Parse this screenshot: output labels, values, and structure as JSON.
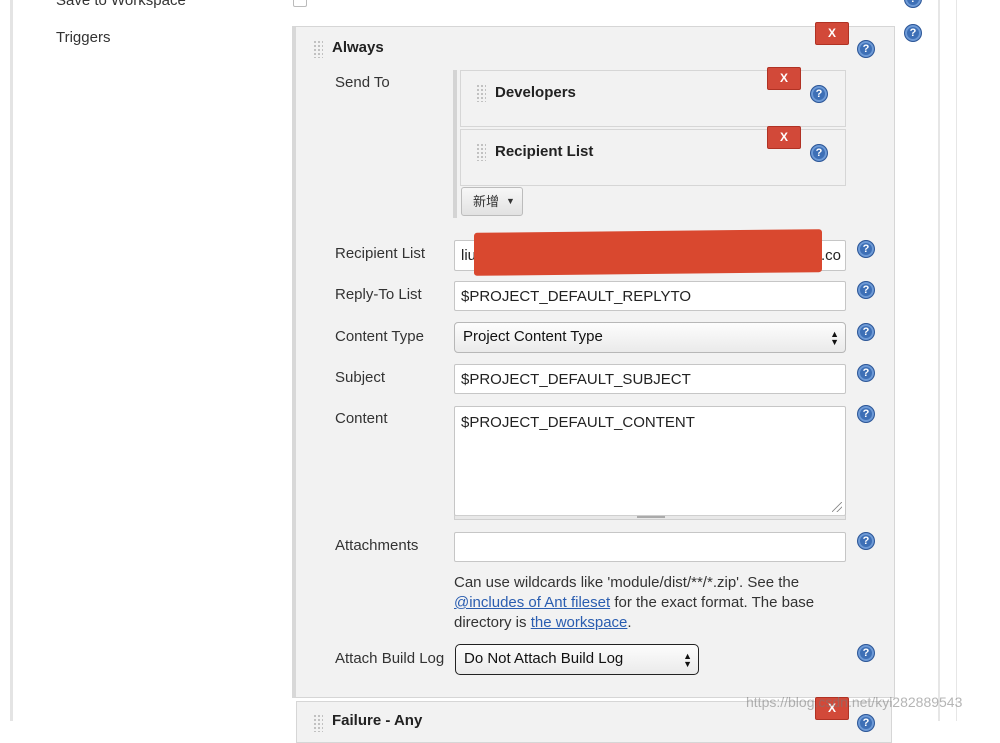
{
  "top_row": {
    "label": "Save to Workspace"
  },
  "triggers": {
    "label": "Triggers"
  },
  "always_block": {
    "title": "Always",
    "delete_label": "X",
    "send_to": {
      "label": "Send To",
      "items": [
        {
          "title": "Developers",
          "delete_label": "X"
        },
        {
          "title": "Recipient List",
          "delete_label": "X"
        }
      ],
      "add_button_label": "新增"
    },
    "recipient_list": {
      "label": "Recipient List",
      "value_start": "liu",
      "value_end": ".co"
    },
    "reply_to": {
      "label": "Reply-To List",
      "value": "$PROJECT_DEFAULT_REPLYTO"
    },
    "content_type": {
      "label": "Content Type",
      "value": "Project Content Type"
    },
    "subject": {
      "label": "Subject",
      "value": "$PROJECT_DEFAULT_SUBJECT"
    },
    "content": {
      "label": "Content",
      "value": "$PROJECT_DEFAULT_CONTENT"
    },
    "attachments": {
      "label": "Attachments",
      "value": "",
      "help_text_1": "Can use wildcards like 'module/dist/**/*.zip'. See the",
      "help_link_1": "@includes of Ant fileset",
      "help_text_2": " for the exact format. The base",
      "help_text_3": "directory is ",
      "help_link_2": "the workspace",
      "help_text_4": "."
    },
    "attach_build_log": {
      "label": "Attach Build Log",
      "value": "Do Not Attach Build Log"
    }
  },
  "next_block": {
    "title": "Failure - Any",
    "delete_label": "X"
  },
  "help_glyph": "?",
  "watermark": "https://blog.csdn.net/kyl282889543"
}
